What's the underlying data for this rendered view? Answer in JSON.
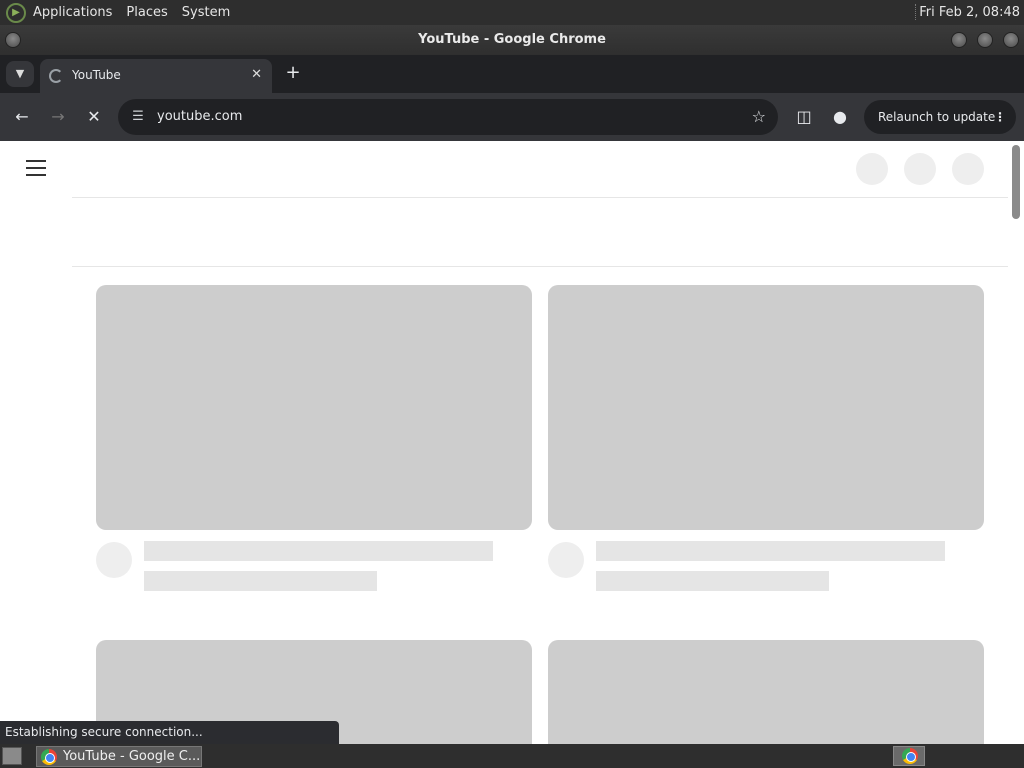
{
  "top_panel": {
    "menus": [
      "Applications",
      "Places",
      "System"
    ],
    "clock": "Fri Feb  2, 08:48"
  },
  "window": {
    "title": "YouTube - Google Chrome"
  },
  "tabs": [
    {
      "label": "YouTube"
    }
  ],
  "toolbar": {
    "url": "youtube.com",
    "relaunch_label": "Relaunch to update"
  },
  "status": "Establishing secure connection...",
  "taskbar": {
    "item_label": "YouTube - Google C..."
  }
}
